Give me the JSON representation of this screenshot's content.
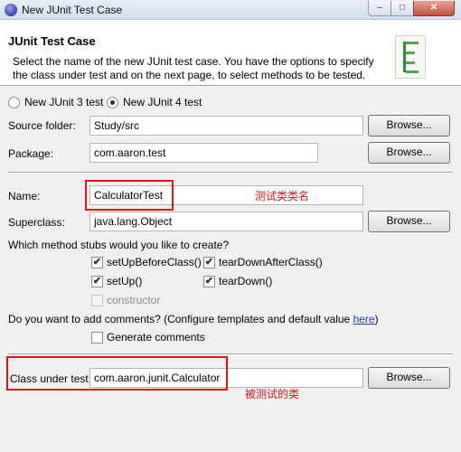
{
  "window": {
    "title": "New JUnit Test Case",
    "minimize_glyph": "–",
    "maximize_glyph": "□",
    "close_glyph": "✕"
  },
  "header": {
    "title": "JUnit Test Case",
    "description": "Select the name of the new JUnit test case. You have the options to specify the class under test and on the next page, to select methods to be tested."
  },
  "version": {
    "option3": "New JUnit 3 test",
    "option4": "New JUnit 4 test",
    "selected": "New JUnit 4 test"
  },
  "form": {
    "source_folder_label": "Source folder:",
    "source_folder_value": "Study/src",
    "package_label": "Package:",
    "package_value": "com.aaron.test",
    "name_label": "Name:",
    "name_value": "CalculatorTest",
    "superclass_label": "Superclass:",
    "superclass_value": "java.lang.Object",
    "browse_label": "Browse..."
  },
  "stubs": {
    "question": "Which method stubs would you like to create?",
    "setUpBeforeClass": "setUpBeforeClass()",
    "tearDownAfterClass": "tearDownAfterClass()",
    "setUp": "setUp()",
    "tearDown": "tearDown()",
    "constructor": "constructor",
    "checked_glyph": "✔"
  },
  "comments": {
    "question": "Do you want to add comments? (Configure templates and default value ",
    "link": "here",
    "close_paren": ")",
    "generate": "Generate comments"
  },
  "class_under_test": {
    "label": "Class under test:",
    "value": "com.aaron.junit.Calculator"
  },
  "annotations": {
    "name_note": "测试类类名",
    "class_note": "被测试的类"
  },
  "colors": {
    "annotation_red": "#d8161b",
    "link_blue": "#1a3ea8"
  }
}
